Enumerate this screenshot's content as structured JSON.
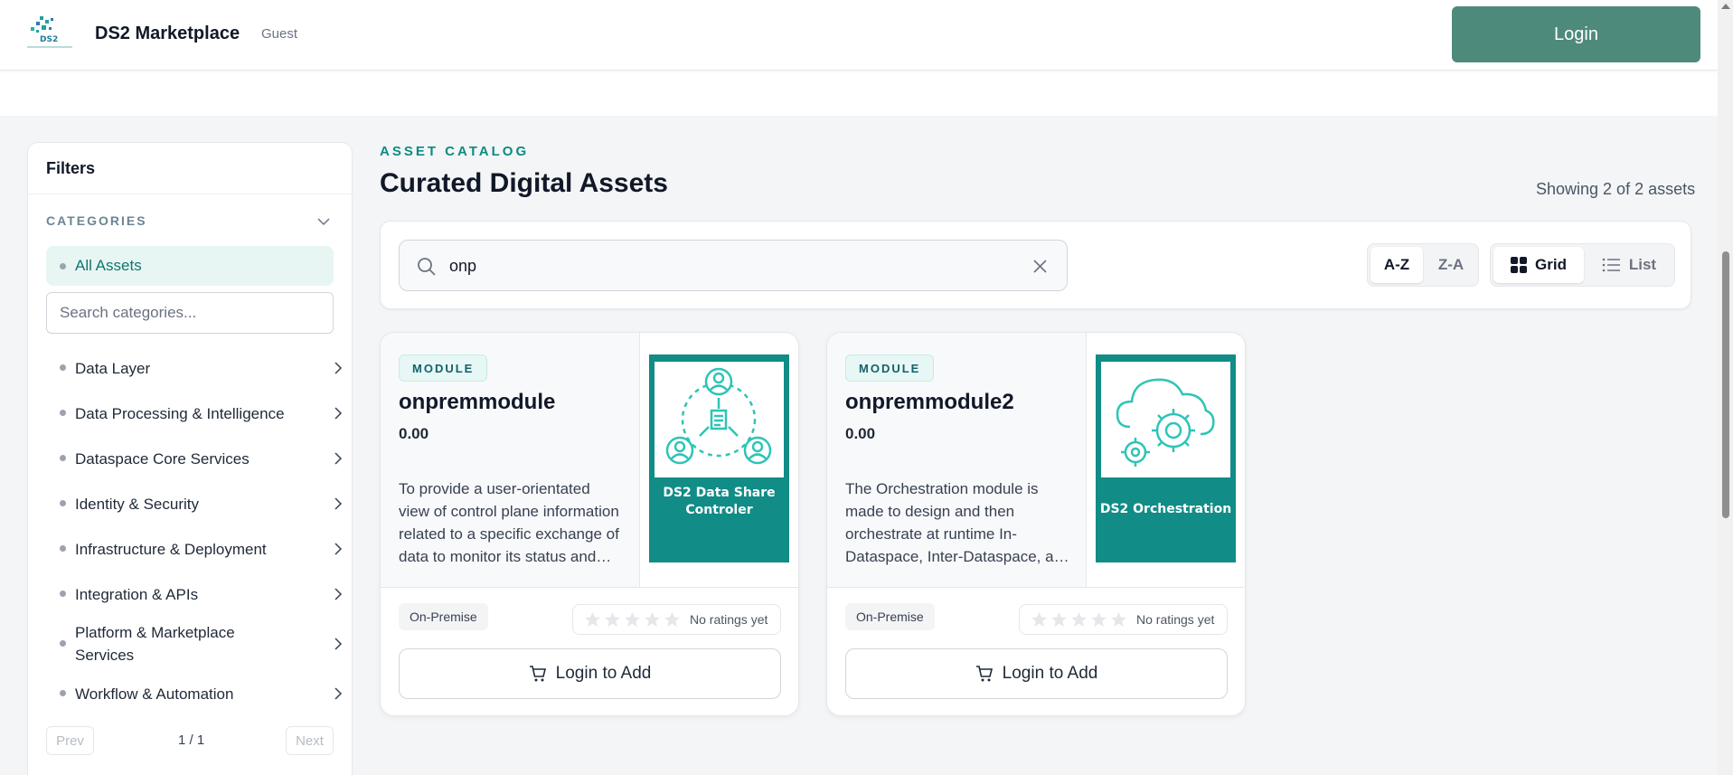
{
  "header": {
    "brand": "DS2 Marketplace",
    "role": "Guest",
    "logo_text": "DS2",
    "login_label": "Login"
  },
  "sidebar": {
    "title": "Filters",
    "categories_heading": "CATEGORIES",
    "all_assets_label": "All Assets",
    "search_placeholder": "Search categories...",
    "items": [
      {
        "label": "Data Layer"
      },
      {
        "label": "Data Processing & Intelligence"
      },
      {
        "label": "Dataspace Core Services"
      },
      {
        "label": "Identity & Security"
      },
      {
        "label": "Infrastructure & Deployment"
      },
      {
        "label": "Integration & APIs"
      },
      {
        "label": "Platform & Marketplace Services"
      },
      {
        "label": "Workflow & Automation"
      }
    ],
    "pager": {
      "prev": "Prev",
      "page": "1 / 1",
      "next": "Next"
    }
  },
  "main": {
    "eyebrow": "ASSET CATALOG",
    "title": "Curated Digital Assets",
    "showing": "Showing 2 of 2 assets",
    "search_value": "onp",
    "sort": {
      "az": "A-Z",
      "za": "Z-A",
      "active": "A-Z"
    },
    "view": {
      "grid": "Grid",
      "list": "List",
      "active": "Grid"
    }
  },
  "cards": [
    {
      "badge": "MODULE",
      "name": "onpremmodule",
      "price": "0.00",
      "description": "To provide a user-orientated view of control plane information related to a specific exchange of data to monitor its status and progress.",
      "thumb_label": "DS2 Data Share Controler",
      "thumb_icon": "people-network-icon",
      "deployment": "On-Premise",
      "rating": 0,
      "rating_text": "No ratings yet",
      "add_label": "Login to Add"
    },
    {
      "badge": "MODULE",
      "name": "onpremmodule2",
      "price": "0.00",
      "description": "The Orchestration module is made to design and then orchestrate at runtime In-Dataspace, Inter-Dataspace, and other workflows.",
      "thumb_label": "DS2 Orchestration",
      "thumb_icon": "cloud-gears-icon",
      "deployment": "On-Premise",
      "rating": 0,
      "rating_text": "No ratings yet",
      "add_label": "Login to Add"
    }
  ],
  "colors": {
    "accent": "#4e8a7c",
    "teal": "#118c86",
    "eyebrow": "#0f8a80"
  }
}
